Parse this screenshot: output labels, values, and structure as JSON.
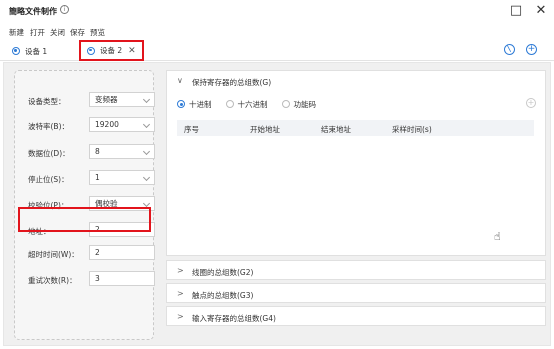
{
  "window": {
    "title": "簡略文件制作",
    "info_icon": "info-icon",
    "minimize": "□",
    "close": "✕"
  },
  "menu": {
    "items": [
      "新建",
      "打开",
      "关闭",
      "保存",
      "预览"
    ]
  },
  "tabs": [
    {
      "label": "设备 1",
      "icon": "gear-icon",
      "active": false
    },
    {
      "label": "设备 2",
      "icon": "gear-icon",
      "active": true,
      "close": "✕"
    }
  ],
  "toolbar_icons": {
    "edit": "⊘",
    "add": "+"
  },
  "device_form": {
    "fields": [
      {
        "label": "设备类型：",
        "value": "变频器",
        "type": "select"
      },
      {
        "label": "波特率(B)：",
        "value": "19200",
        "type": "select"
      },
      {
        "label": "数据位(D)：",
        "value": "8",
        "type": "select"
      },
      {
        "label": "停止位(S)：",
        "value": "1",
        "type": "select"
      },
      {
        "label": "校验位(P)：",
        "value": "偶校验",
        "type": "select"
      },
      {
        "label": "地址：",
        "value": "2",
        "type": "input"
      },
      {
        "label": "超时时间(W)：",
        "value": "2",
        "type": "input"
      },
      {
        "label": "重试次数(R)：",
        "value": "3",
        "type": "input"
      }
    ]
  },
  "sections": {
    "holding": {
      "title": "保持寄存器的总组数(G)",
      "chevron": "∨",
      "radios": [
        "十进制",
        "十六进制",
        "功能码"
      ],
      "selected": "十进制",
      "table_headers": [
        "序号",
        "开始地址",
        "结束地址",
        "采样时间(s)"
      ]
    },
    "coil": {
      "title": "线圈的总组数(G2)",
      "chevron": ">"
    },
    "contact": {
      "title": "触点的总组数(G3)",
      "chevron": ">"
    },
    "input_reg": {
      "title": "输入寄存器的总组数(G4)",
      "chevron": ">"
    }
  },
  "colors": {
    "accent": "#2e7bd6",
    "highlight": "#e2141c",
    "panel_bg": "#f0f0f0"
  }
}
